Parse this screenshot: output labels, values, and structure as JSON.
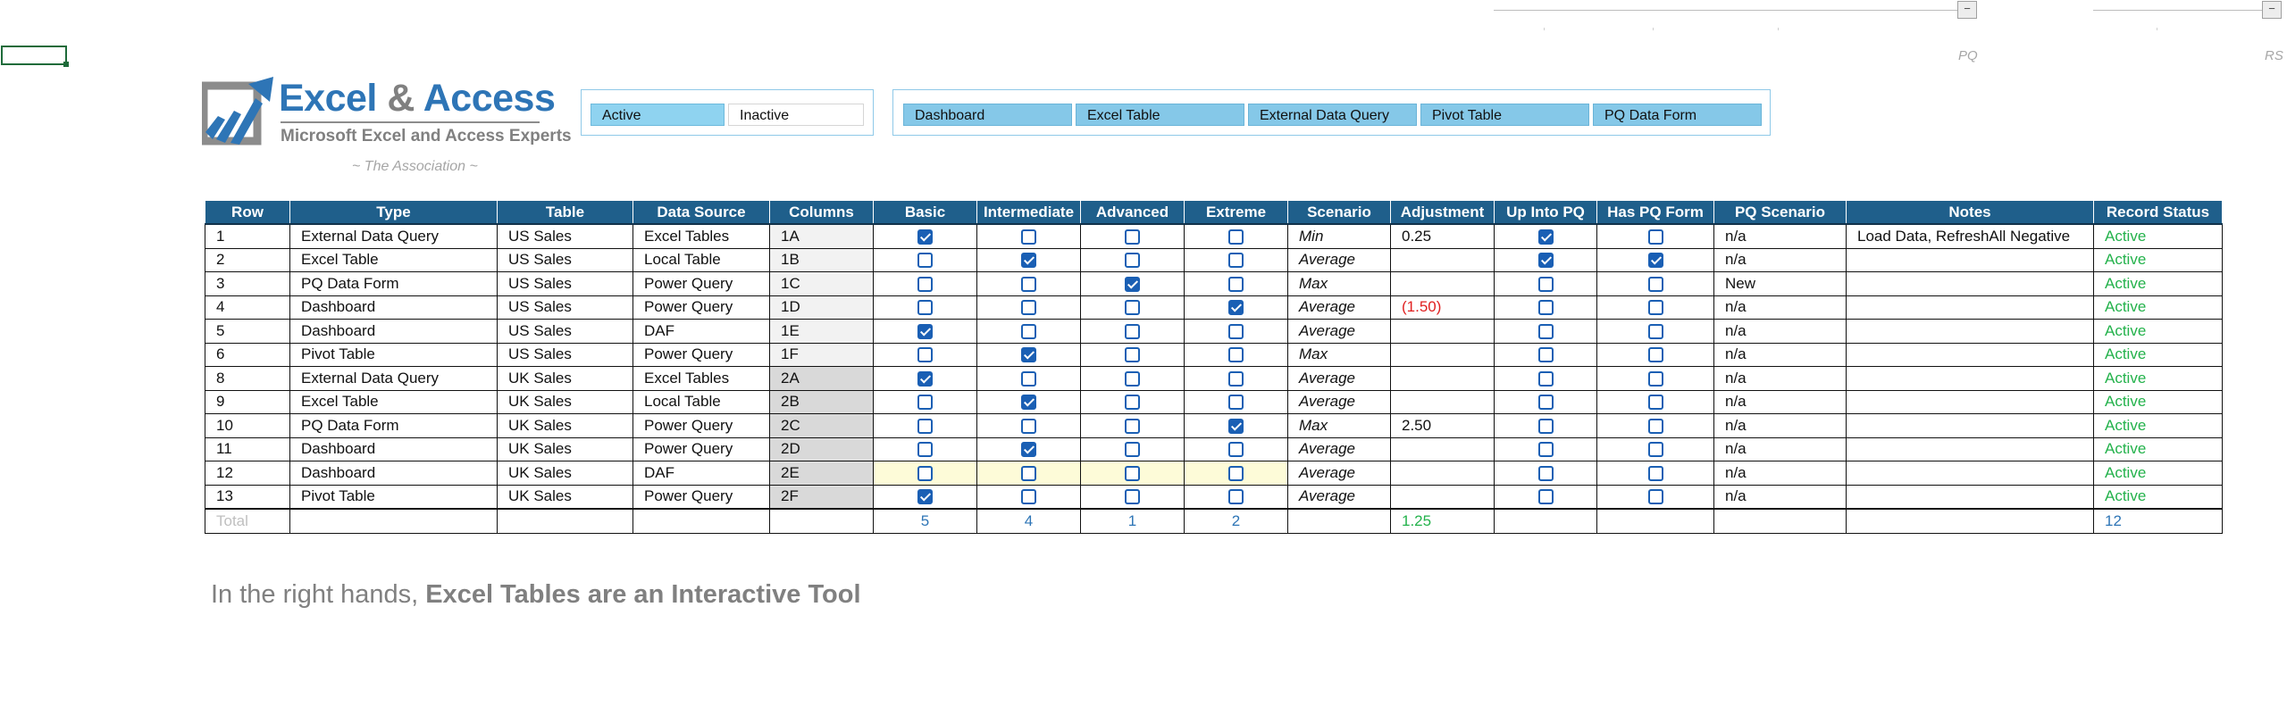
{
  "controls": {
    "pq_label": "PQ",
    "rs_label": "RS",
    "slider_glyph": "−"
  },
  "logo": {
    "word1": "Excel",
    "amp": " & ",
    "word2": "Access",
    "subtitle": "Microsoft Excel and Access Experts",
    "tagline": "~ The Association ~",
    "icon": "chart-arrow-logo-icon"
  },
  "status_slicer": {
    "items": [
      {
        "label": "Active",
        "selected": true
      },
      {
        "label": "Inactive",
        "selected": false
      }
    ]
  },
  "type_slicer": {
    "items": [
      {
        "label": "Dashboard"
      },
      {
        "label": "Excel Table"
      },
      {
        "label": "External Data Query"
      },
      {
        "label": "Pivot Table"
      },
      {
        "label": "PQ Data Form"
      }
    ]
  },
  "table": {
    "headers": [
      "Row",
      "Type",
      "Table",
      "Data Source",
      "Columns",
      "Basic",
      "Intermediate",
      "Advanced",
      "Extreme",
      "Scenario",
      "Adjustment",
      "Up Into PQ",
      "Has PQ Form",
      "PQ Scenario",
      "Notes",
      "Record Status"
    ],
    "rows": [
      {
        "row": "1",
        "type": "External Data Query",
        "table": "US Sales",
        "source": "Excel Tables",
        "columns": "1A",
        "basic": true,
        "intermediate": false,
        "advanced": false,
        "extreme": false,
        "scenario": "Min",
        "adjustment": "0.25",
        "up_pq": true,
        "has_form": false,
        "pq_scenario": "n/a",
        "notes": "Load Data, RefreshAll Negative",
        "status": "Active"
      },
      {
        "row": "2",
        "type": "Excel Table",
        "table": "US Sales",
        "source": "Local Table",
        "columns": "1B",
        "basic": false,
        "intermediate": true,
        "advanced": false,
        "extreme": false,
        "scenario": "Average",
        "adjustment": "",
        "up_pq": true,
        "has_form": true,
        "pq_scenario": "n/a",
        "notes": "",
        "status": "Active"
      },
      {
        "row": "3",
        "type": "PQ Data Form",
        "table": "US Sales",
        "source": "Power Query",
        "columns": "1C",
        "basic": false,
        "intermediate": false,
        "advanced": true,
        "extreme": false,
        "scenario": "Max",
        "adjustment": "",
        "up_pq": false,
        "has_form": false,
        "pq_scenario": "New",
        "notes": "",
        "status": "Active"
      },
      {
        "row": "4",
        "type": "Dashboard",
        "table": "US Sales",
        "source": "Power Query",
        "columns": "1D",
        "basic": false,
        "intermediate": false,
        "advanced": false,
        "extreme": true,
        "scenario": "Average",
        "adjustment": "(1.50)",
        "up_pq": false,
        "has_form": false,
        "pq_scenario": "n/a",
        "notes": "",
        "status": "Active"
      },
      {
        "row": "5",
        "type": "Dashboard",
        "table": "US Sales",
        "source": "DAF",
        "columns": "1E",
        "basic": true,
        "intermediate": false,
        "advanced": false,
        "extreme": false,
        "scenario": "Average",
        "adjustment": "",
        "up_pq": false,
        "has_form": false,
        "pq_scenario": "n/a",
        "notes": "",
        "status": "Active"
      },
      {
        "row": "6",
        "type": "Pivot Table",
        "table": "US Sales",
        "source": "Power Query",
        "columns": "1F",
        "basic": false,
        "intermediate": true,
        "advanced": false,
        "extreme": false,
        "scenario": "Max",
        "adjustment": "",
        "up_pq": false,
        "has_form": false,
        "pq_scenario": "n/a",
        "notes": "",
        "status": "Active"
      },
      {
        "row": "8",
        "type": "External Data Query",
        "table": "UK Sales",
        "source": "Excel Tables",
        "columns": "2A",
        "basic": true,
        "intermediate": false,
        "advanced": false,
        "extreme": false,
        "scenario": "Average",
        "adjustment": "",
        "up_pq": false,
        "has_form": false,
        "pq_scenario": "n/a",
        "notes": "",
        "status": "Active"
      },
      {
        "row": "9",
        "type": "Excel Table",
        "table": "UK Sales",
        "source": "Local Table",
        "columns": "2B",
        "basic": false,
        "intermediate": true,
        "advanced": false,
        "extreme": false,
        "scenario": "Average",
        "adjustment": "",
        "up_pq": false,
        "has_form": false,
        "pq_scenario": "n/a",
        "notes": "",
        "status": "Active"
      },
      {
        "row": "10",
        "type": "PQ Data Form",
        "table": "UK Sales",
        "source": "Power Query",
        "columns": "2C",
        "basic": false,
        "intermediate": false,
        "advanced": false,
        "extreme": true,
        "scenario": "Max",
        "adjustment": "2.50",
        "up_pq": false,
        "has_form": false,
        "pq_scenario": "n/a",
        "notes": "",
        "status": "Active"
      },
      {
        "row": "11",
        "type": "Dashboard",
        "table": "UK Sales",
        "source": "Power Query",
        "columns": "2D",
        "basic": false,
        "intermediate": true,
        "advanced": false,
        "extreme": false,
        "scenario": "Average",
        "adjustment": "",
        "up_pq": false,
        "has_form": false,
        "pq_scenario": "n/a",
        "notes": "",
        "status": "Active"
      },
      {
        "row": "12",
        "type": "Dashboard",
        "table": "UK Sales",
        "source": "DAF",
        "columns": "2E",
        "basic": false,
        "intermediate": false,
        "advanced": false,
        "extreme": false,
        "scenario": "Average",
        "adjustment": "",
        "up_pq": false,
        "has_form": false,
        "pq_scenario": "n/a",
        "notes": "",
        "status": "Active",
        "highlight": true
      },
      {
        "row": "13",
        "type": "Pivot Table",
        "table": "UK Sales",
        "source": "Power Query",
        "columns": "2F",
        "basic": true,
        "intermediate": false,
        "advanced": false,
        "extreme": false,
        "scenario": "Average",
        "adjustment": "",
        "up_pq": false,
        "has_form": false,
        "pq_scenario": "n/a",
        "notes": "",
        "status": "Active"
      }
    ],
    "total": {
      "label": "Total",
      "basic": "5",
      "intermediate": "4",
      "advanced": "1",
      "extreme": "2",
      "adjustment": "1.25",
      "status": "12"
    }
  },
  "footer": {
    "lead": "In the right hands, ",
    "bold": "Excel Tables are an Interactive Tool"
  },
  "colors": {
    "header_bg": "#1f5f8b",
    "accent": "#2e75b6",
    "checkbox": "#1a5fb4",
    "active_green": "#23b24b",
    "negative_red": "#e02020"
  }
}
